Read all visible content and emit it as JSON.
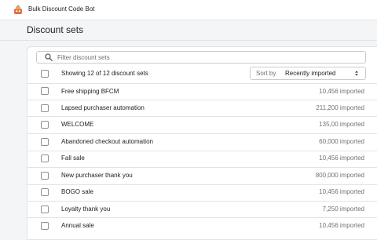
{
  "app": {
    "title": "Bulk Discount Code Bot",
    "logo_icon": "bot-logo-icon",
    "accent": "#e86b3a"
  },
  "page": {
    "title": "Discount sets"
  },
  "search": {
    "placeholder": "Filter discount sets",
    "value": ""
  },
  "list": {
    "showing_text": "Showing 12 of 12 discount sets",
    "sort_prefix": "Sort by",
    "sort_value": "Recently imported",
    "rows": [
      {
        "name": "Free shipping BFCM",
        "count": "10,456 imported"
      },
      {
        "name": "Lapsed purchaser automation",
        "count": "211,200 imported"
      },
      {
        "name": "WELCOME",
        "count": "135,00 imported"
      },
      {
        "name": "Abandoned checkout automation",
        "count": "60,000 imported"
      },
      {
        "name": "Fall sale",
        "count": "10,456 imported"
      },
      {
        "name": "New purchaser thank you",
        "count": "800,000 imported"
      },
      {
        "name": "BOGO sale",
        "count": "10,456 imported"
      },
      {
        "name": "Loyalty thank you",
        "count": "7,250 imported"
      },
      {
        "name": "Annual sale",
        "count": "10,456 imported"
      }
    ]
  }
}
